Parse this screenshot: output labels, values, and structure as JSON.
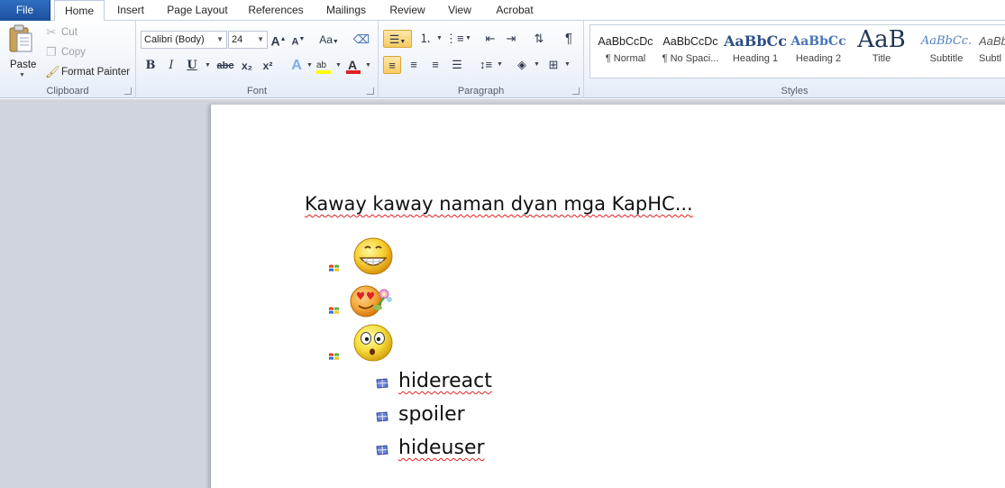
{
  "tabs": [
    "File",
    "Home",
    "Insert",
    "Page Layout",
    "References",
    "Mailings",
    "Review",
    "View",
    "Acrobat"
  ],
  "clipboard": {
    "paste": "Paste",
    "cut": "Cut",
    "copy": "Copy",
    "format_painter": "Format Painter",
    "label": "Clipboard"
  },
  "font": {
    "name": "Calibri (Body)",
    "size": "24",
    "label": "Font",
    "bold": "B",
    "italic": "I",
    "underline": "U",
    "strike": "abc",
    "subscript": "x₂",
    "superscript": "x²",
    "change_case": "Aa",
    "grow": "A",
    "shrink": "A"
  },
  "paragraph": {
    "label": "Paragraph",
    "pilcrow": "¶"
  },
  "styles": {
    "label": "Styles",
    "items": [
      {
        "preview": "AaBbCcDc",
        "name": "¶ Normal"
      },
      {
        "preview": "AaBbCcDc",
        "name": "¶ No Spaci..."
      },
      {
        "preview": "AaBbCc",
        "name": "Heading 1"
      },
      {
        "preview": "AaBbCc",
        "name": "Heading 2"
      },
      {
        "preview": "AaB",
        "name": "Title"
      },
      {
        "preview": "AaBbCc.",
        "name": "Subtitle"
      },
      {
        "preview": "AaBbC",
        "name": "Subtl"
      }
    ]
  },
  "document": {
    "heading": "Kaway kaway naman dyan mga KapHC...",
    "emoji_items": [
      "grinning-face",
      "heart-eyes-flower-face",
      "surprised-face"
    ],
    "sub_items": [
      "hidereact",
      "spoiler",
      "hideuser"
    ]
  },
  "colors": {
    "file_tab": "#2a62b4",
    "spell_underline": "#e02020",
    "highlight_selected": "#f8cb62"
  }
}
